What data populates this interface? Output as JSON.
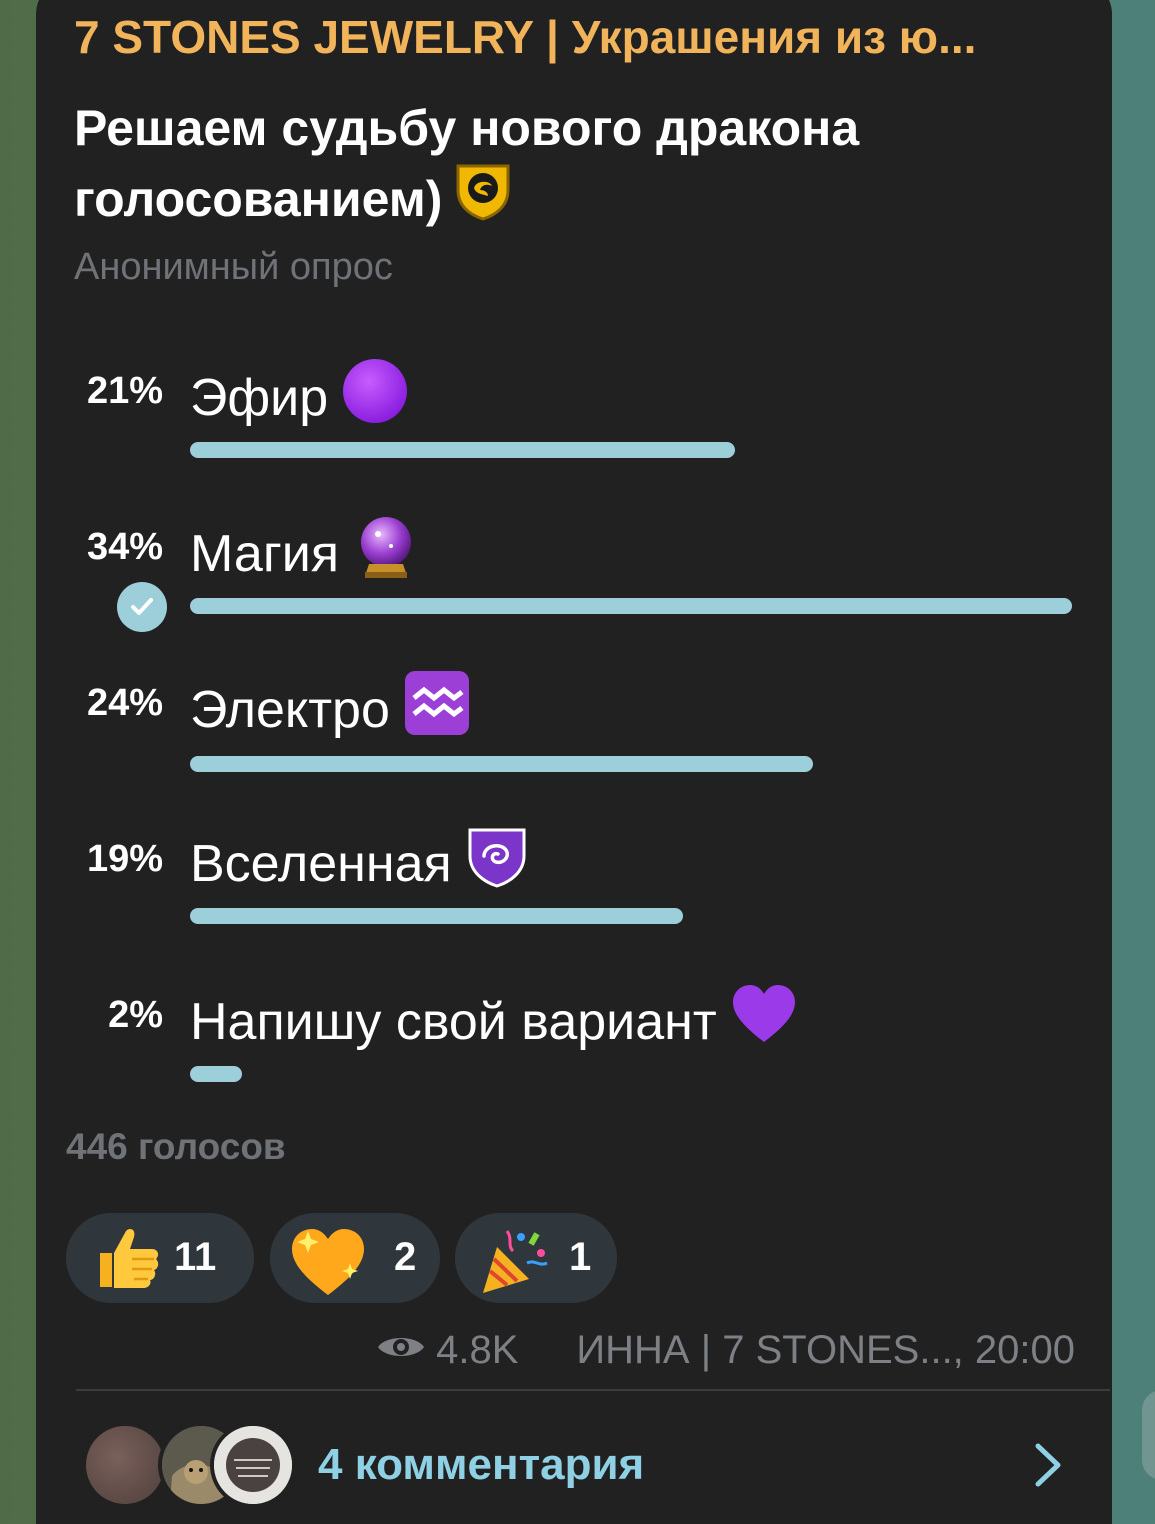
{
  "post": {
    "channel_name": "7 STONES JEWELRY | Украшения из ю...",
    "question": "Решаем судьбу нового дракона голосованием)",
    "poll_type": "Анонимный опрос",
    "options": [
      {
        "percent_label": "21%",
        "label": "Эфир",
        "percent": 21,
        "emoji": "purple-circle-icon",
        "selected": false
      },
      {
        "percent_label": "34%",
        "label": "Магия",
        "percent": 34,
        "emoji": "crystal-ball-icon",
        "selected": true
      },
      {
        "percent_label": "24%",
        "label": "Электро",
        "percent": 24,
        "emoji": "aquarius-icon",
        "selected": false
      },
      {
        "percent_label": "19%",
        "label": "Вселенная",
        "percent": 19,
        "emoji": "galaxy-shield-icon",
        "selected": false
      },
      {
        "percent_label": "2%",
        "label": "Напишу свой вариант",
        "percent": 2,
        "emoji": "purple-heart-icon",
        "selected": false
      }
    ],
    "total_votes": "446 голосов",
    "reactions": [
      {
        "emoji": "thumbs-up-icon",
        "count": "11"
      },
      {
        "emoji": "sparkling-heart-icon",
        "count": "2"
      },
      {
        "emoji": "party-popper-icon",
        "count": "1"
      }
    ],
    "views": "4.8K",
    "author_time": "ИННА | 7 STONES..., 20:00",
    "comments_label": "4 комментария"
  },
  "colors": {
    "card_bg": "#212121",
    "channel_name": "#f2b45a",
    "bar": "#9ccfda",
    "muted": "#6f7378",
    "link": "#8fd0e4"
  }
}
